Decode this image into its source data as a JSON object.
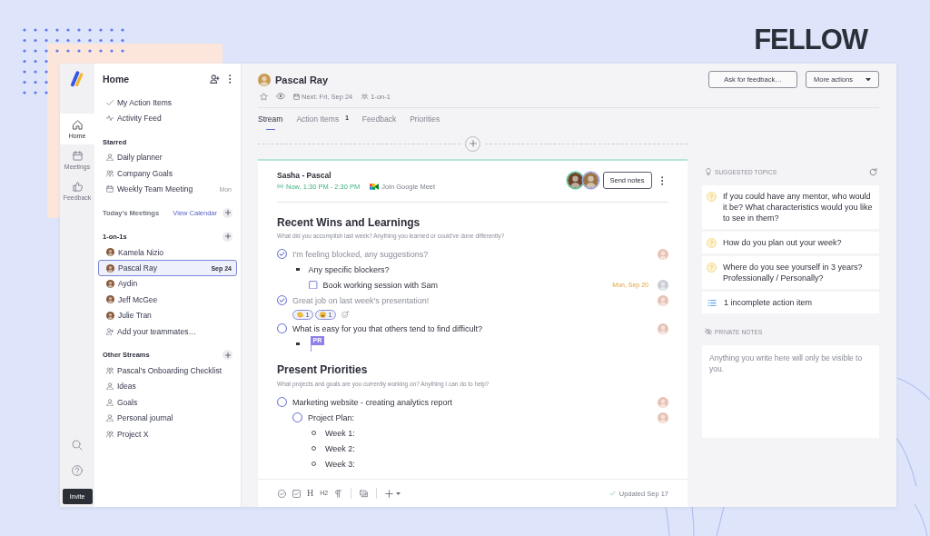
{
  "brand": {
    "wordmark": "FELLOW"
  },
  "rail": {
    "items": [
      {
        "label": "Home",
        "kind": "home",
        "selected": true
      },
      {
        "label": "Meetings",
        "kind": "calendar",
        "selected": false
      },
      {
        "label": "Feedback",
        "kind": "thumbs",
        "selected": false
      }
    ],
    "invite": "Invite"
  },
  "sidebar": {
    "title": "Home",
    "groups": [
      {
        "items": [
          {
            "label": "My Action Items",
            "kind": "check",
            "selected": false
          },
          {
            "label": "Activity Feed",
            "kind": "pulse",
            "selected": false
          }
        ]
      },
      {
        "heading": "Starred",
        "kind": "strong",
        "add": false,
        "items": [
          {
            "label": "Daily planner",
            "kind": "person",
            "selected": false
          },
          {
            "label": "Company Goals",
            "kind": "group",
            "selected": false
          },
          {
            "label": "Weekly Team Meeting",
            "kind": "calendar",
            "meta": "Mon",
            "selected": false
          }
        ]
      },
      {
        "heading": "Today's Meetings",
        "kind": "muted",
        "link": "View Calendar",
        "add": true
      },
      {
        "heading": "1-on-1s",
        "kind": "strong",
        "add": true,
        "items": [
          {
            "label": "Kamela Nizio",
            "kind": "avatar",
            "selected": false
          },
          {
            "label": "Pascal Ray",
            "kind": "avatar",
            "meta": "Sep 24",
            "selected": true
          },
          {
            "label": "Aydin",
            "kind": "avatar",
            "selected": false
          },
          {
            "label": "Jeff McGee",
            "kind": "avatar",
            "selected": false
          },
          {
            "label": "Julie Tran",
            "kind": "avatar",
            "selected": false
          },
          {
            "label": "Add your teammates…",
            "kind": "add",
            "selected": false
          }
        ]
      },
      {
        "heading": "Other Streams",
        "kind": "strong",
        "add": true,
        "items": [
          {
            "label": "Pascal's Onboarding Checklist",
            "kind": "group",
            "selected": false
          },
          {
            "label": "Ideas",
            "kind": "person",
            "selected": false
          },
          {
            "label": "Goals",
            "kind": "person",
            "selected": false
          },
          {
            "label": "Personal journal",
            "kind": "person",
            "selected": false
          },
          {
            "label": "Project X",
            "kind": "group",
            "selected": false
          }
        ]
      }
    ]
  },
  "header": {
    "name": "Pascal Ray",
    "starred": false,
    "next": "Next: Fri, Sep 24",
    "type": "1-on-1",
    "buttons": [
      {
        "label": "Ask for feedback…",
        "kind": "plain"
      },
      {
        "label": "More actions",
        "kind": "menu"
      }
    ]
  },
  "tabs": [
    {
      "label": "Stream",
      "selected": true
    },
    {
      "label": "Action Items",
      "badge": "1",
      "selected": false
    },
    {
      "label": "Feedback",
      "selected": false
    },
    {
      "label": "Priorities",
      "selected": false
    }
  ],
  "meeting": {
    "title": "Sasha - Pascal",
    "time": "Now, 1:30 PM - 2:30 PM",
    "call": "Join Google Meet",
    "send": "Send notes",
    "sections": [
      {
        "title": "Recent Wins and Learnings",
        "prompt": "What did you accomplish last week? Anything you learned or could've done differently?",
        "items": [
          {
            "kind": "topic",
            "text": "I'm feeling blocked, any suggestions?",
            "checked": true,
            "children": [
              {
                "kind": "bullet",
                "text": "Any specific blockers?",
                "children": [
                  {
                    "kind": "action",
                    "text": "Book working session with Sam",
                    "checked": false,
                    "due": "Mon, Sep 20"
                  }
                ]
              }
            ]
          },
          {
            "kind": "topic",
            "text": "Great job on last week's presentation!",
            "checked": true,
            "reactions": [
              {
                "kind": "clap",
                "count": "1"
              },
              {
                "kind": "laugh",
                "count": "1"
              }
            ]
          },
          {
            "kind": "topic",
            "text": "What is easy for you that others tend to find difficult?",
            "checked": false,
            "children": [
              {
                "kind": "bullet",
                "cursor": "PR"
              }
            ]
          }
        ]
      },
      {
        "title": "Present Priorities",
        "prompt": "What projects and goals are you currently working on? Anything I can do to help?",
        "items": [
          {
            "kind": "topic",
            "text": "Marketing website - creating analytics report",
            "checked": false,
            "children": [
              {
                "kind": "topic",
                "text": "Project Plan:",
                "checked": false,
                "children": [
                  {
                    "kind": "bullet",
                    "text": "Week 1:"
                  },
                  {
                    "kind": "bullet",
                    "text": "Week 2:"
                  },
                  {
                    "kind": "bullet",
                    "text": "Week 3:"
                  }
                ]
              }
            ]
          }
        ]
      }
    ],
    "toolbar": [
      {
        "kind": "topic"
      },
      {
        "kind": "action"
      },
      {
        "kind": "heading",
        "label": "H"
      },
      {
        "kind": "heading",
        "label": "H2"
      },
      {
        "kind": "paragraph"
      },
      {
        "kind": "separator"
      },
      {
        "kind": "image"
      },
      {
        "kind": "separator"
      },
      {
        "kind": "insert"
      }
    ],
    "updated": "Updated Sep 17"
  },
  "suggested": {
    "title": "SUGGESTED TOPICS",
    "items": [
      {
        "kind": "question",
        "text": "If you could have any mentor, who would it be? What characteristics would you like to see in them?"
      },
      {
        "kind": "question",
        "text": "How do you plan out your week?"
      },
      {
        "kind": "question",
        "text": "Where do you see yourself in 3 years? Professionally / Personally?"
      },
      {
        "kind": "actions",
        "text": "1 incomplete action item"
      }
    ]
  },
  "private_notes": {
    "title": "PRIVATE NOTES",
    "placeholder": "Anything you write here will only be visible to you."
  }
}
